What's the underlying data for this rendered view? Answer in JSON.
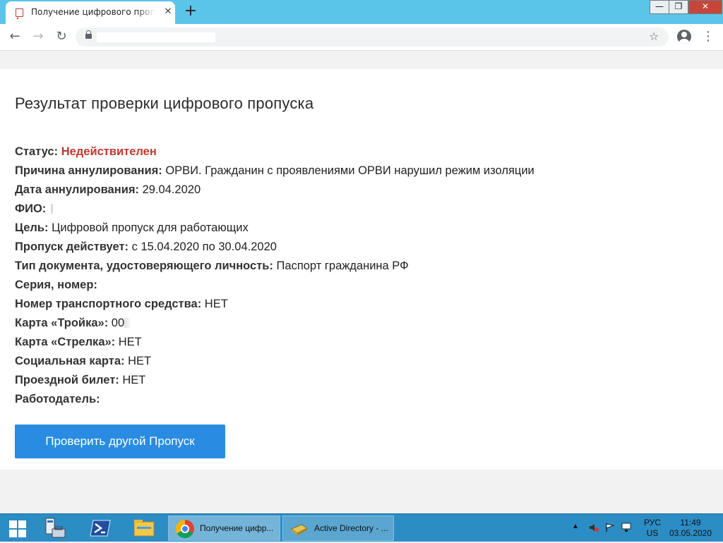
{
  "browser": {
    "tab_title": "Получение цифрового пропуска",
    "tab_close": "✕",
    "new_tab": "+",
    "window_controls": {
      "minimize": "—",
      "maximize": "❐",
      "close": "✕"
    },
    "nav": {
      "back": "←",
      "forward": "→",
      "reload": "↻",
      "star": "☆",
      "menu": "⋮"
    }
  },
  "page": {
    "title": "Результат проверки цифрового пропуска",
    "fields": [
      {
        "label": "Статус:",
        "value": "Недействителен",
        "style": "red"
      },
      {
        "label": "Причина аннулирования:",
        "value": "ОРВИ. Гражданин с проявлениями ОРВИ нарушил режим изоляции"
      },
      {
        "label": "Дата аннулирования:",
        "value": "29.04.2020"
      },
      {
        "label": "ФИО:",
        "value": ""
      },
      {
        "label": "Цель:",
        "value": "Цифровой пропуск для работающих"
      },
      {
        "label": "Пропуск действует:",
        "value": "с 15.04.2020 по 30.04.2020"
      },
      {
        "label": "Тип документа, удостоверяющего личность:",
        "value": "Паспорт гражданина РФ"
      },
      {
        "label": "Серия, номер:",
        "value": ""
      },
      {
        "label": "Номер транспортного средства:",
        "value": "НЕТ"
      },
      {
        "label": "Карта «Тройка»:",
        "value": "00"
      },
      {
        "label": "Карта «Стрелка»:",
        "value": "НЕТ"
      },
      {
        "label": "Социальная карта:",
        "value": "НЕТ"
      },
      {
        "label": "Проездной билет:",
        "value": "НЕТ"
      },
      {
        "label": "Работодатель:",
        "value": ""
      }
    ],
    "check_button": "Проверить другой Пропуск"
  },
  "taskbar": {
    "tasks": [
      {
        "label": "Получение цифр..."
      },
      {
        "label": "Active Directory - ..."
      }
    ],
    "tray_arrow": "▲",
    "lang_top": "РУС",
    "lang_bottom": "US",
    "time": "11:49",
    "date": "03.05.2020"
  },
  "colors": {
    "tabstrip": "#5bc5e9",
    "status_red": "#c0392b",
    "button_blue": "#2a8be2",
    "taskbar": "#2c8dc5"
  }
}
